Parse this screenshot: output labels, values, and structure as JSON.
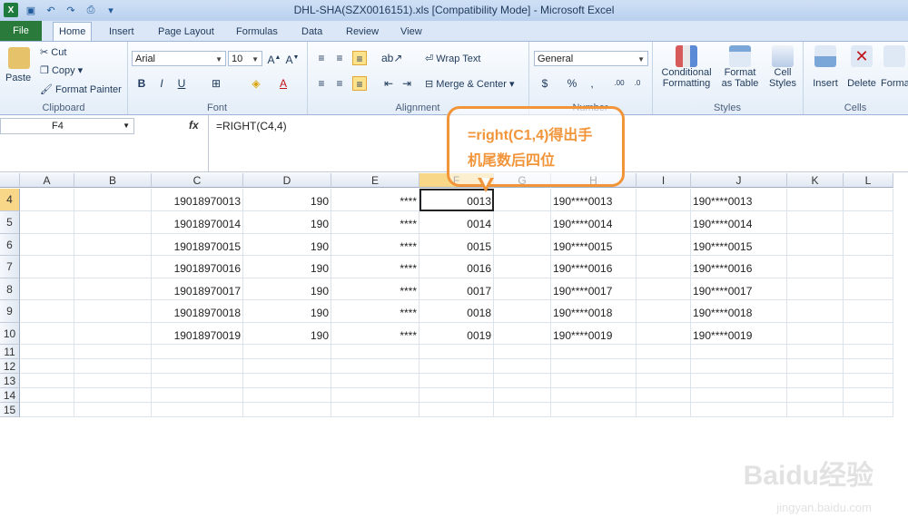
{
  "window": {
    "title": "DHL-SHA(SZX0016151).xls  [Compatibility Mode]  -  Microsoft Excel"
  },
  "tabs": [
    "File",
    "Home",
    "Insert",
    "Page Layout",
    "Formulas",
    "Data",
    "Review",
    "View"
  ],
  "ribbon": {
    "clipboard": {
      "paste": "Paste",
      "cut": "Cut",
      "copy": "Copy",
      "format_painter": "Format Painter",
      "label": "Clipboard"
    },
    "font": {
      "name": "Arial",
      "size": "10",
      "label": "Font"
    },
    "alignment": {
      "wrap": "Wrap Text",
      "merge": "Merge & Center",
      "label": "Alignment"
    },
    "number": {
      "format": "General",
      "label": "Number"
    },
    "styles": {
      "cond1": "Conditional",
      "cond2": "Formatting",
      "fmt1": "Format",
      "fmt2": "as Table",
      "cell1": "Cell",
      "cell2": "Styles",
      "label": "Styles"
    },
    "cells": {
      "insert": "Insert",
      "delete": "Delete",
      "format": "Forma",
      "label": "Cells"
    }
  },
  "formula_bar": {
    "name_box": "F4",
    "fx": "fx",
    "formula": "=RIGHT(C4,4)"
  },
  "columns": [
    "A",
    "B",
    "C",
    "D",
    "E",
    "F",
    "G",
    "H",
    "I",
    "J",
    "K",
    "L"
  ],
  "rows": [
    {
      "n": "4",
      "C": "19018970013",
      "D": "190",
      "E": "****",
      "F": "0013",
      "H": "190****0013",
      "J": "190****0013"
    },
    {
      "n": "5",
      "C": "19018970014",
      "D": "190",
      "E": "****",
      "F": "0014",
      "H": "190****0014",
      "J": "190****0014"
    },
    {
      "n": "6",
      "C": "19018970015",
      "D": "190",
      "E": "****",
      "F": "0015",
      "H": "190****0015",
      "J": "190****0015"
    },
    {
      "n": "7",
      "C": "19018970016",
      "D": "190",
      "E": "****",
      "F": "0016",
      "H": "190****0016",
      "J": "190****0016"
    },
    {
      "n": "8",
      "C": "19018970017",
      "D": "190",
      "E": "****",
      "F": "0017",
      "H": "190****0017",
      "J": "190****0017"
    },
    {
      "n": "9",
      "C": "19018970018",
      "D": "190",
      "E": "****",
      "F": "0018",
      "H": "190****0018",
      "J": "190****0018"
    },
    {
      "n": "10",
      "C": "19018970019",
      "D": "190",
      "E": "****",
      "F": "0019",
      "H": "190****0019",
      "J": "190****0019"
    },
    {
      "n": "11"
    },
    {
      "n": "12"
    },
    {
      "n": "13"
    },
    {
      "n": "14"
    },
    {
      "n": "15"
    }
  ],
  "callout": {
    "line1": "=right(C1,4)得出手",
    "line2": "机尾数后四位"
  },
  "watermark": {
    "brand": "Baidu经验",
    "url": "jingyan.baidu.com"
  }
}
